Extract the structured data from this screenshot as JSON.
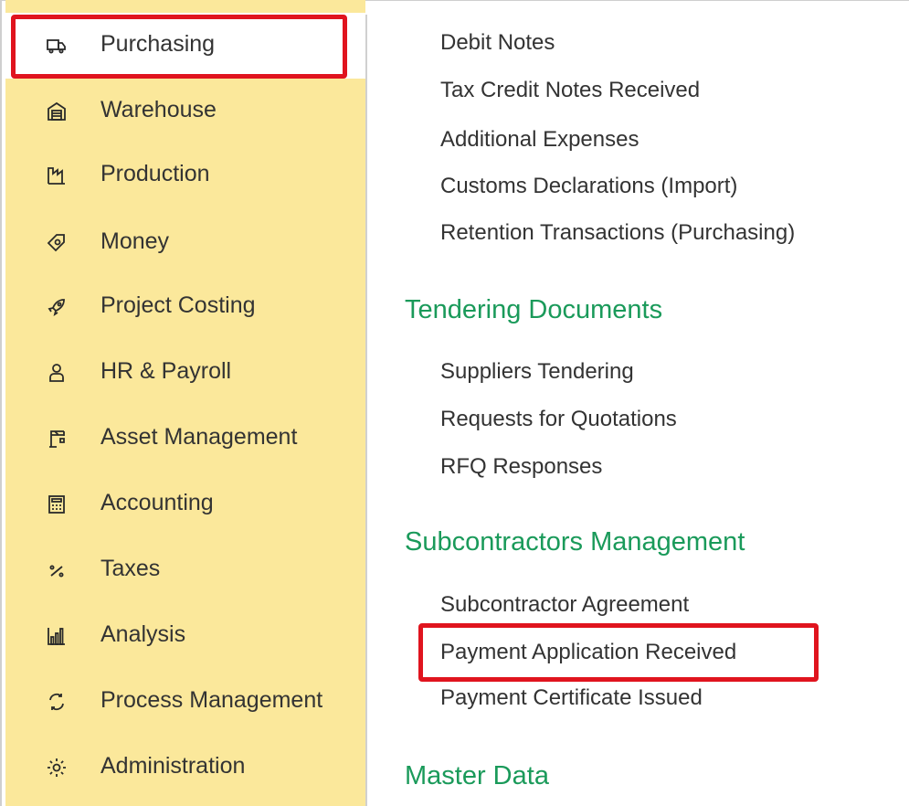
{
  "sidebar": {
    "items": [
      {
        "label": "Purchasing",
        "icon": "truck-icon"
      },
      {
        "label": "Warehouse",
        "icon": "warehouse-icon"
      },
      {
        "label": "Production",
        "icon": "factory-icon"
      },
      {
        "label": "Money",
        "icon": "money-tag-icon"
      },
      {
        "label": "Project Costing",
        "icon": "rocket-icon"
      },
      {
        "label": "HR & Payroll",
        "icon": "person-icon"
      },
      {
        "label": "Asset Management",
        "icon": "crane-icon"
      },
      {
        "label": "Accounting",
        "icon": "calculator-icon"
      },
      {
        "label": "Taxes",
        "icon": "percent-icon"
      },
      {
        "label": "Analysis",
        "icon": "bar-chart-icon"
      },
      {
        "label": "Process Management",
        "icon": "cycle-arrows-icon"
      },
      {
        "label": "Administration",
        "icon": "gear-icon"
      }
    ]
  },
  "menu": {
    "purchasing_links": [
      "Debit Notes",
      "Tax Credit Notes Received",
      "Additional Expenses",
      "Customs Declarations (Import)",
      "Retention Transactions (Purchasing)"
    ],
    "tendering": {
      "heading": "Tendering Documents",
      "links": [
        "Suppliers Tendering",
        "Requests for Quotations",
        "RFQ Responses"
      ]
    },
    "subcontractors": {
      "heading": "Subcontractors Management",
      "links": [
        "Subcontractor Agreement",
        "Payment Application Received",
        "Payment Certificate Issued"
      ]
    },
    "master_data": {
      "heading": "Master Data"
    }
  },
  "colors": {
    "sidebar_bg": "#fbe89b",
    "section_heading": "#1a9a5a",
    "highlight": "#e0141e"
  }
}
